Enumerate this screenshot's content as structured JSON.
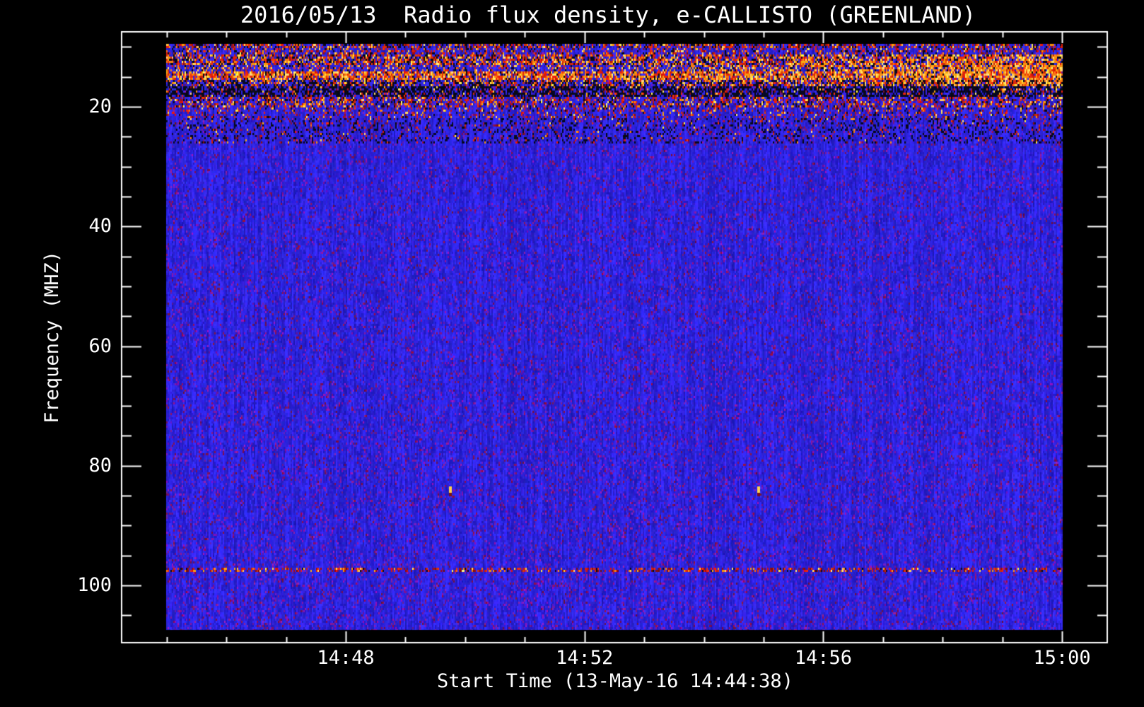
{
  "page": {
    "background": "#000000"
  },
  "chart_data": {
    "type": "heatmap",
    "subtype": "radio-spectrogram",
    "title": "2016/05/13  Radio flux density, e-CALLISTO (GREENLAND)",
    "xlabel": "Start Time (13-May-16 14:44:38)",
    "ylabel": "Frequency (MHZ)",
    "legend": "none",
    "x_axis": {
      "start_time": "13-May-16 14:44:38",
      "major_ticks": [
        {
          "minute": 48,
          "label": "14:48"
        },
        {
          "minute": 52,
          "label": "14:52"
        },
        {
          "minute": 56,
          "label": "14:56"
        },
        {
          "minute": 60,
          "label": "15:00"
        }
      ],
      "minor_tick_minutes": [
        45,
        46,
        47,
        49,
        50,
        51,
        53,
        54,
        55,
        57,
        58,
        59
      ]
    },
    "y_axis": {
      "unit": "MHz",
      "inverted": true,
      "major_ticks": [
        {
          "mhz": 20,
          "label": "20"
        },
        {
          "mhz": 40,
          "label": "40"
        },
        {
          "mhz": 60,
          "label": "60"
        },
        {
          "mhz": 80,
          "label": "80"
        },
        {
          "mhz": 100,
          "label": "100"
        }
      ],
      "minor_tick_mhz": [
        10,
        15,
        25,
        30,
        35,
        45,
        50,
        55,
        65,
        70,
        75,
        85,
        90,
        95,
        105
      ],
      "data_range_mhz": [
        9.5,
        107.5
      ]
    },
    "colormap": {
      "body_blue": "#2d23e0",
      "dark_blue": "#1510a0",
      "speckle_purple": "#7a1eb4",
      "speckle_maroon": "#8c1450",
      "rfi_dark_red": "#8a0d08",
      "rfi_red": "#d92408",
      "rfi_orange": "#f58a0a",
      "rfi_yellow": "#ffd24a",
      "black": "#000000",
      "axis_white": "#ffffff"
    },
    "rfi_bands": [
      {
        "from": 9.4,
        "to": 10.2,
        "speckle": 0.45,
        "black": 0.15,
        "right_boost": 0,
        "warmth": 0.4
      },
      {
        "from": 10.2,
        "to": 11.2,
        "speckle": 0.28,
        "black": 0.08,
        "right_boost": 0,
        "warmth": 0.3
      },
      {
        "from": 11.2,
        "to": 12.8,
        "speckle": 0.6,
        "black": 0.18,
        "right_boost": 0.75,
        "warmth": 0.55
      },
      {
        "from": 12.8,
        "to": 14.0,
        "speckle": 0.3,
        "black": 0.1,
        "right_boost": 0.95,
        "warmth": 0.8
      },
      {
        "from": 14.0,
        "to": 15.4,
        "speckle": 0.78,
        "black": 0.1,
        "right_boost": 0.9,
        "warmth": 0.75
      },
      {
        "from": 15.4,
        "to": 16.6,
        "speckle": 0.45,
        "black": 0.3,
        "right_boost": 0.85,
        "warmth": 0.6
      },
      {
        "from": 16.6,
        "to": 18.1,
        "speckle": 0.28,
        "black": 0.55,
        "right_boost": 0.3,
        "warmth": 0.4
      },
      {
        "from": 18.1,
        "to": 20.1,
        "speckle": 0.38,
        "black": 0.1,
        "right_boost": 0,
        "warmth": 0.35
      },
      {
        "from": 20.1,
        "to": 21.8,
        "speckle": 0.18,
        "black": 0.05,
        "right_boost": 0,
        "warmth": 0.25
      },
      {
        "from": 21.8,
        "to": 25.9,
        "speckle": 0.07,
        "black": 0.15,
        "right_boost": 0,
        "warmth": 0.1
      },
      {
        "from": 96.8,
        "to": 97.6,
        "speckle": 0.38,
        "black": 0.03,
        "right_boost": 0,
        "warmth": 0.15
      }
    ],
    "bright_points": [
      {
        "time_min_after_1400": 49.75,
        "freq_mhz": 84.1
      },
      {
        "time_min_after_1400": 54.92,
        "freq_mhz": 84.1
      }
    ],
    "body_noise": {
      "purple_speckle_density": 0.05,
      "maroon_speckle_density": 0.035,
      "vertical_striation": true
    }
  }
}
